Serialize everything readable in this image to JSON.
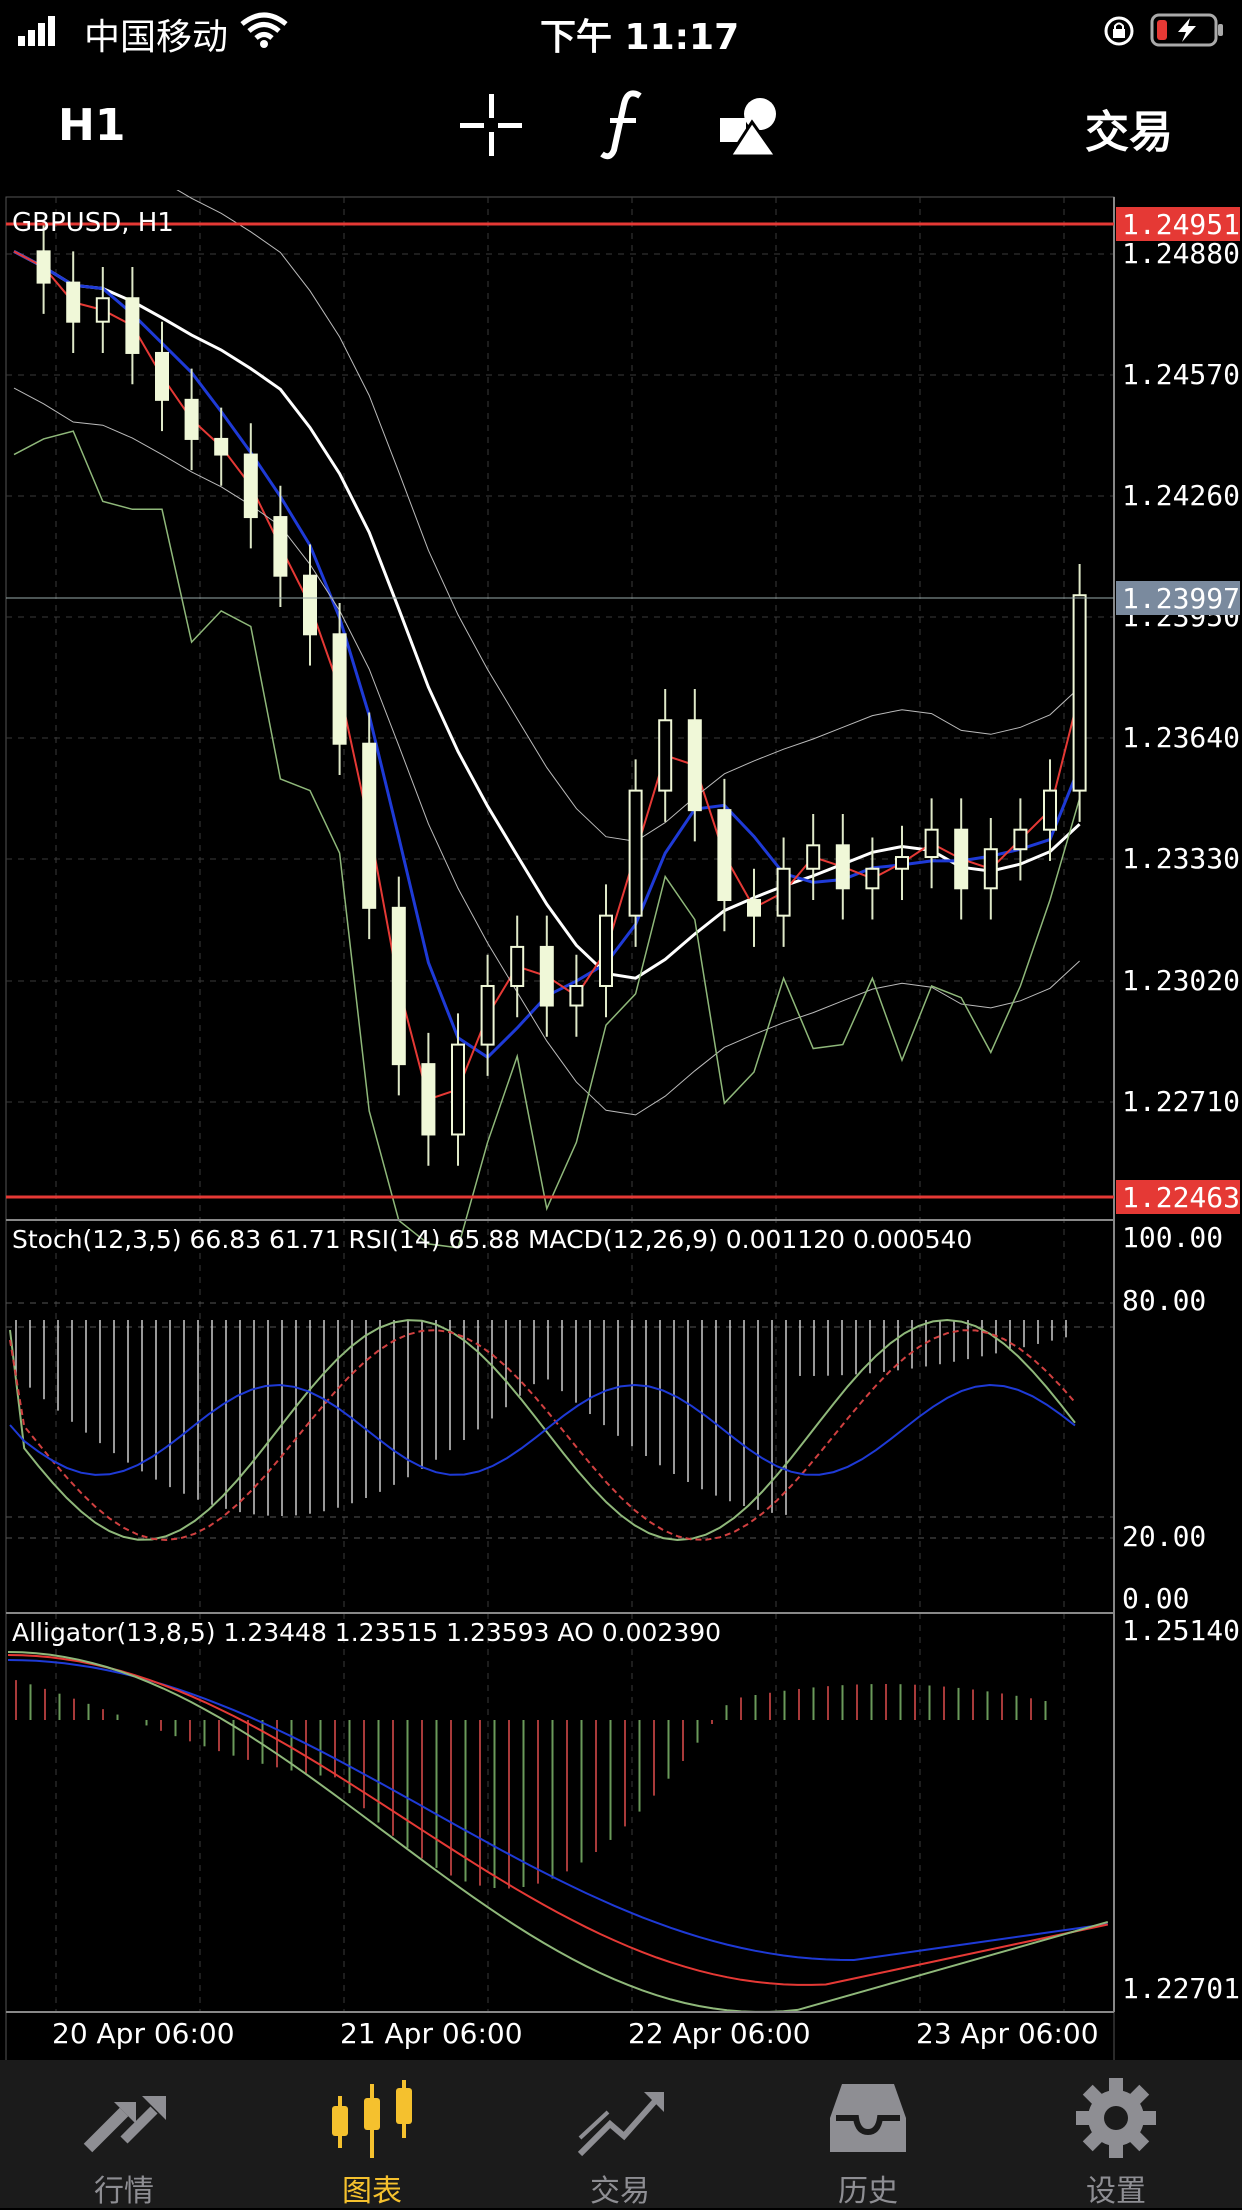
{
  "status": {
    "carrier": "中国移动",
    "time": "下午 11:17"
  },
  "toolbar": {
    "timeframe": "H1",
    "crosshair_icon": "crosshair-icon",
    "indicators_icon": "function-icon",
    "objects_icon": "shapes-icon",
    "trade_label": "交易"
  },
  "chart": {
    "symbol": "GBPUSD, H1",
    "price_labels": [
      "1.24880",
      "1.24570",
      "1.24260",
      "1.23950",
      "1.23640",
      "1.23330",
      "1.23020",
      "1.22710"
    ],
    "high_line": "1.24951",
    "current_price": "1.23997",
    "low_line": "1.22463",
    "osc_header": "Stoch(12,3,5) 66.83 61.71 RSI(14) 65.88 MACD(12,26,9) 0.001120 0.000540",
    "osc_labels": [
      "100.00",
      "80.00",
      "20.00",
      "0.00"
    ],
    "alligator_header": "Alligator(13,8,5) 1.23448 1.23515 1.23593 AO 0.002390",
    "alligator_labels": [
      "1.25140",
      "1.22701"
    ],
    "time_labels": [
      "20 Apr 06:00",
      "21 Apr 06:00",
      "22 Apr 06:00",
      "23 Apr 06:00"
    ]
  },
  "chart_data": {
    "type": "line",
    "series": [
      {
        "name": "GBPUSD, H1",
        "x": [
          0,
          2,
          4,
          6,
          8,
          10,
          12,
          14,
          16,
          18,
          20,
          22,
          24,
          26,
          28,
          30,
          32,
          34,
          36,
          38,
          40,
          42,
          44,
          46,
          48,
          50,
          52,
          54,
          56,
          58,
          60,
          62,
          64,
          66,
          68,
          70,
          72
        ],
        "values": [
          1.2488,
          1.248,
          1.247,
          1.2476,
          1.2462,
          1.245,
          1.244,
          1.2436,
          1.242,
          1.2405,
          1.239,
          1.2362,
          1.232,
          1.228,
          1.2262,
          1.2285,
          1.23,
          1.231,
          1.2295,
          1.23,
          1.2318,
          1.235,
          1.2368,
          1.2345,
          1.2322,
          1.2318,
          1.233,
          1.2336,
          1.2325,
          1.233,
          1.2333,
          1.234,
          1.2325,
          1.2335,
          1.234,
          1.235,
          1.24
        ]
      }
    ],
    "ylim": [
      1.2246,
      1.2495
    ]
  },
  "tabs": [
    {
      "label": "行情",
      "icon": "quotes-icon",
      "active": false
    },
    {
      "label": "图表",
      "icon": "chart-candles-icon",
      "active": true
    },
    {
      "label": "交易",
      "icon": "trade-icon",
      "active": false
    },
    {
      "label": "历史",
      "icon": "history-icon",
      "active": false
    },
    {
      "label": "设置",
      "icon": "settings-gear-icon",
      "active": false
    }
  ],
  "colors": {
    "red_line": "#e53935",
    "current_price_bg": "#7a8a9e",
    "tab_active": "#f5c12e"
  }
}
